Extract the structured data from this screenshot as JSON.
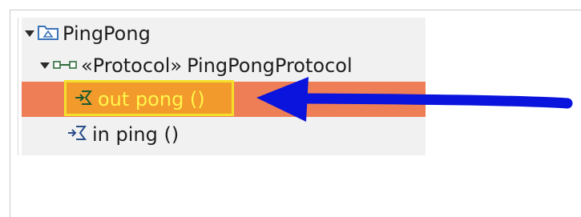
{
  "tree": {
    "root": {
      "label": "PingPong",
      "icon": "package-folder-icon",
      "expanded": true
    },
    "protocol": {
      "stereotype": "«Protocol»",
      "name": "PingPongProtocol",
      "icon": "protocol-icon",
      "expanded": true
    },
    "messages": [
      {
        "label": "out pong ()",
        "icon": "out-message-icon",
        "selected": true
      },
      {
        "label": "in ping ()",
        "icon": "in-message-icon",
        "selected": false
      }
    ]
  },
  "colors": {
    "selection": "#ee7e55",
    "highlight_fill": "#f29b2c",
    "highlight_border": "#f4e02b",
    "selected_text": "#fff64b",
    "arrow": "#0a14dc"
  }
}
